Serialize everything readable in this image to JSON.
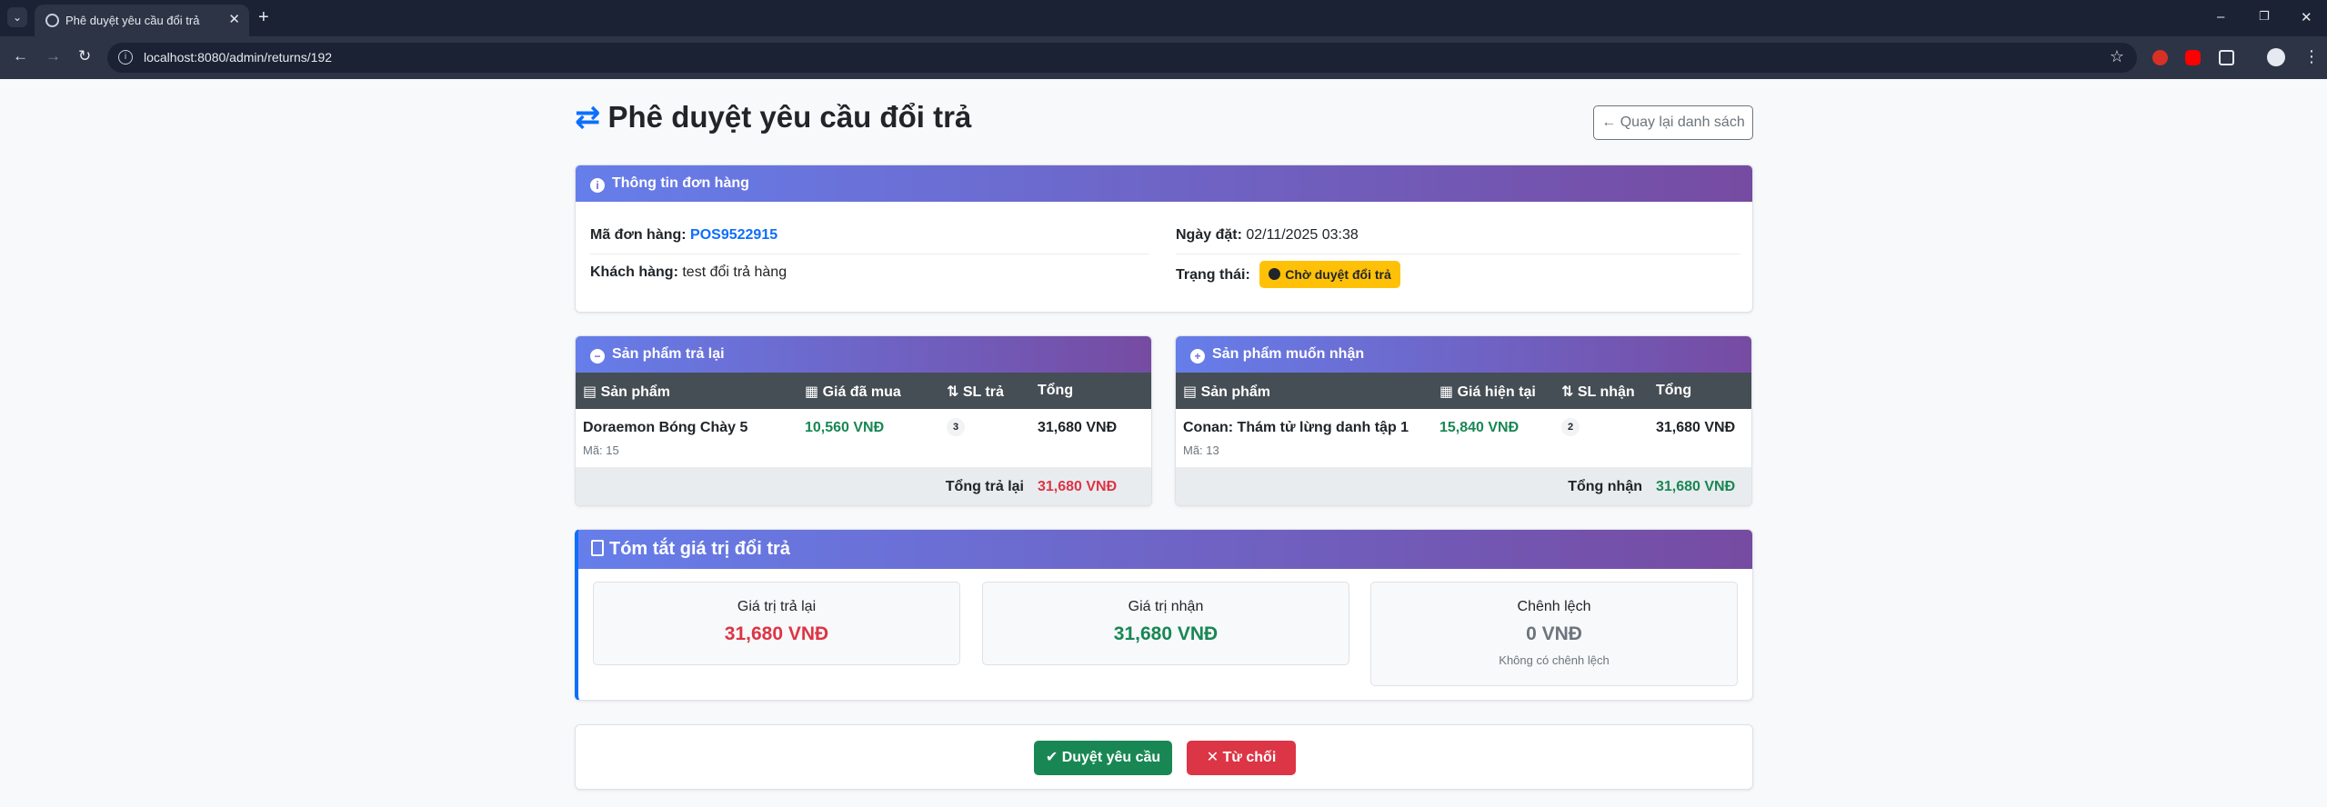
{
  "browser": {
    "tab_title": "Phê duyệt yêu cầu đổi trả",
    "url": "localhost:8080/admin/returns/192"
  },
  "page": {
    "title": "Phê duyệt yêu cầu đổi trả",
    "back_label": "Quay lại danh sách"
  },
  "order_info": {
    "header": "Thông tin đơn hàng",
    "order_code_label": "Mã đơn hàng:",
    "order_code": "POS9522915",
    "customer_label": "Khách hàng:",
    "customer": "test đổi trả hàng",
    "date_label": "Ngày đặt:",
    "date": "02/11/2025 03:38",
    "status_label": "Trạng thái:",
    "status": "Chờ duyệt đổi trả"
  },
  "returned": {
    "header": "Sản phẩm trả lại",
    "columns": [
      "Sản phẩm",
      "Giá đã mua",
      "SL trả",
      "Tổng"
    ],
    "items": [
      {
        "name": "Doraemon Bóng Chày 5",
        "code": "Mã: 15",
        "price": "10,560 VNĐ",
        "qty": "3",
        "total": "31,680 VNĐ"
      }
    ],
    "total_label": "Tổng trả lại",
    "total": "31,680 VNĐ"
  },
  "received": {
    "header": "Sản phẩm muốn nhận",
    "columns": [
      "Sản phẩm",
      "Giá hiện tại",
      "SL nhận",
      "Tổng"
    ],
    "items": [
      {
        "name": "Conan: Thám tử lừng danh tập 1",
        "code": "Mã: 13",
        "price": "15,840 VNĐ",
        "qty": "2",
        "total": "31,680 VNĐ"
      }
    ],
    "total_label": "Tổng nhận",
    "total": "31,680 VNĐ"
  },
  "summary": {
    "header": "Tóm tắt giá trị đổi trả",
    "return_label": "Giá trị trả lại",
    "return_value": "31,680 VNĐ",
    "receive_label": "Giá trị nhận",
    "receive_value": "31,680 VNĐ",
    "diff_label": "Chênh lệch",
    "diff_value": "0 VNĐ",
    "diff_note": "Không có chênh lệch"
  },
  "actions": {
    "approve": "Duyệt yêu cầu",
    "reject": "Từ chối"
  },
  "colors": {
    "primary": "#0d6efd",
    "success": "#198754",
    "danger": "#dc3545",
    "warning": "#ffc107",
    "header_gradient_start": "#667eea",
    "header_gradient_end": "#764ba2"
  }
}
